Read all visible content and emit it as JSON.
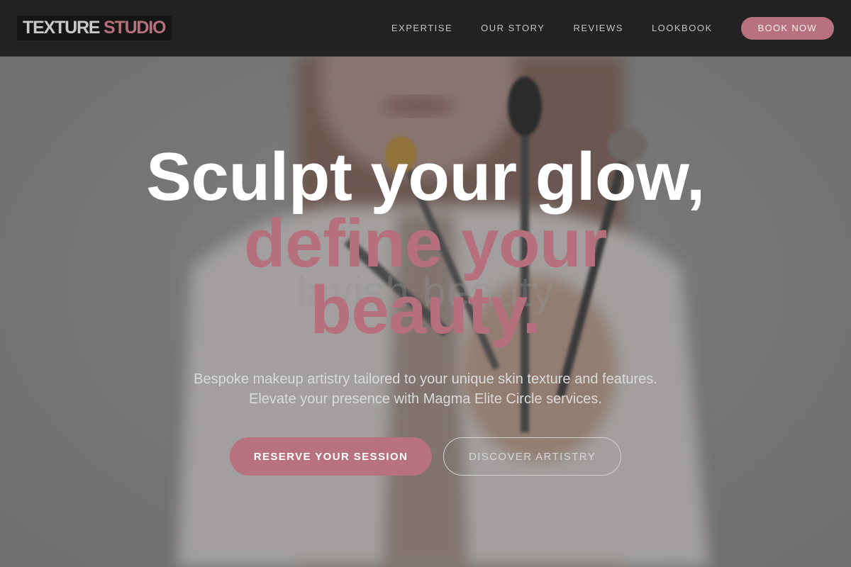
{
  "nav": {
    "logo_part1": "TEXTURE",
    "logo_part2": "STUDIO",
    "links": [
      "EXPERTISE",
      "OUR STORY",
      "REVIEWS",
      "LOOKBOOK"
    ],
    "book_label": "BOOK NOW"
  },
  "hero": {
    "headline_line1": "Sculpt your glow,",
    "headline_line2": "define your",
    "headline_line3": "beauty.",
    "watermark": "lavish beauty",
    "subtitle_line1": "Bespoke makeup artistry tailored to your unique skin texture and features.",
    "subtitle_line2": "Elevate your presence with Magma Elite Circle services.",
    "primary_cta": "RESERVE YOUR SESSION",
    "secondary_cta": "DISCOVER ARTISTRY"
  },
  "colors": {
    "accent": "#b8717e",
    "nav_background": "#222222",
    "headline_white": "#ffffff",
    "headline_accent": "#b56f7d"
  }
}
